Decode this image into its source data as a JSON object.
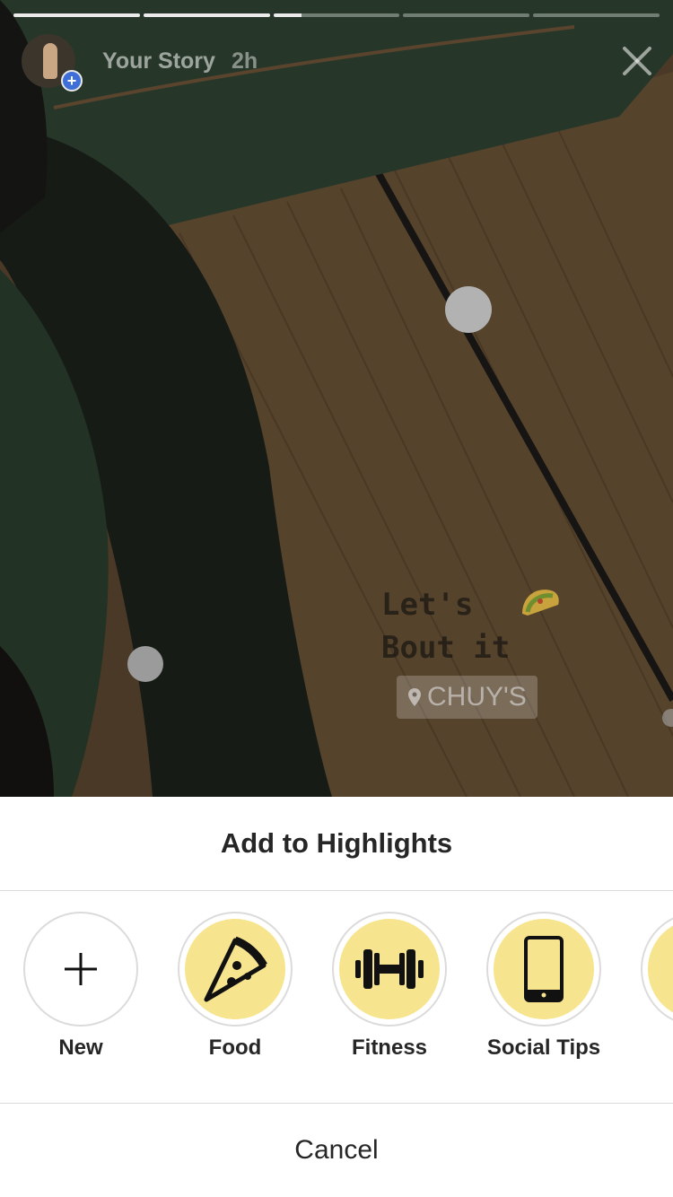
{
  "story": {
    "title": "Your Story",
    "time": "2h",
    "progress_segments": [
      1,
      1,
      0.22,
      0,
      0
    ],
    "caption": "Let's\nBout it",
    "location_sticker": "CHUY'S",
    "icons": {
      "close": "close-icon",
      "add": "plus-badge-icon",
      "location": "location-pin-icon",
      "sticker": "taco-emoji"
    }
  },
  "sheet": {
    "title": "Add to Highlights",
    "highlights": [
      {
        "label": "New",
        "icon": "plus-icon"
      },
      {
        "label": "Food",
        "icon": "pizza-icon"
      },
      {
        "label": "Fitness",
        "icon": "dumbbell-icon"
      },
      {
        "label": "Social Tips",
        "icon": "smartphone-icon"
      }
    ],
    "cancel_label": "Cancel",
    "colors": {
      "highlight_fill": "#f7e48e",
      "text": "#262626",
      "divider": "#dbdbdb"
    }
  }
}
